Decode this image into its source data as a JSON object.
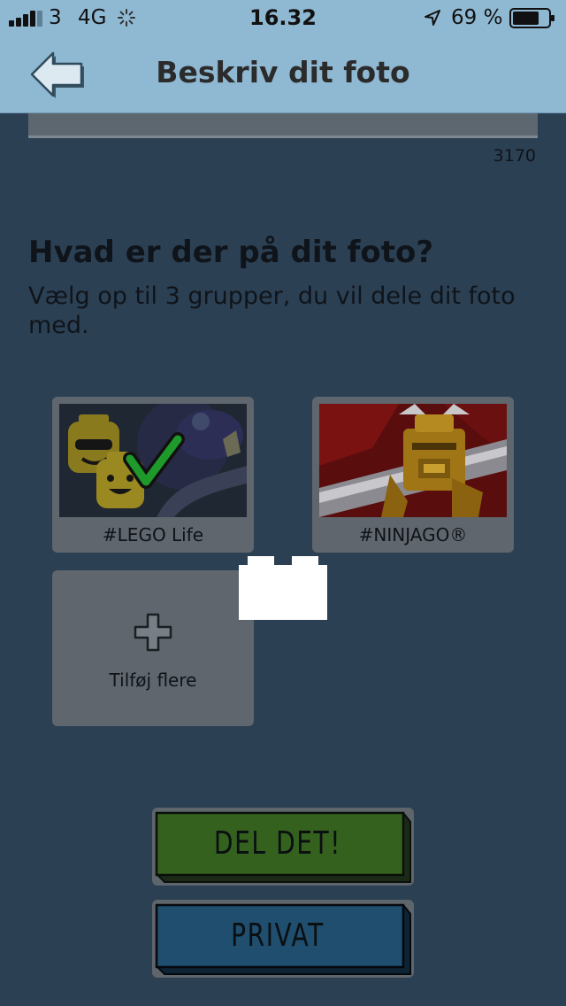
{
  "status_bar": {
    "carrier": "3",
    "network": "4G",
    "time": "16.32",
    "battery": "69 %"
  },
  "header": {
    "title": "Beskriv dit foto",
    "back_icon": "arrow-left-icon"
  },
  "description": {
    "char_count": "3170"
  },
  "groups_section": {
    "heading": "Hvad er der på dit foto?",
    "subheading": "Vælg op til 3 grupper, du vil dele dit foto med.",
    "groups": [
      {
        "label": "#LEGO Life",
        "selected": true
      },
      {
        "label": "#NINJAGO®",
        "selected": false
      }
    ],
    "add_more_label": "Tilføj flere"
  },
  "actions": {
    "share_label": "DEL DET!",
    "private_label": "PRIVAT"
  },
  "colors": {
    "header_bg": "#8fb8d2",
    "page_bg": "#2c4054",
    "share_button": "#2a4a20",
    "private_button": "#1f4e6e",
    "checkmark": "#1e9a2a"
  }
}
